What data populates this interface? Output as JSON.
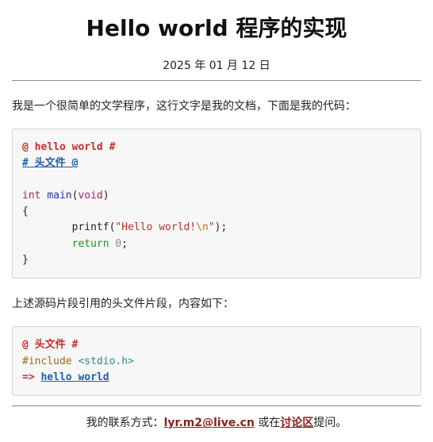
{
  "header": {
    "title": "Hello world 程序的实现",
    "date": "2025 年 01 月 12 日"
  },
  "intro": {
    "text": "我是一个很简单的文学程序，这行文字是我的文档，下面是我的代码："
  },
  "code_main": {
    "line1": {
      "meta": "@ hello world #"
    },
    "line2": {
      "link": "# 头文件 @"
    },
    "line4": {
      "kw": "int",
      "sp": " ",
      "fn": "main",
      "open": "(",
      "kw2": "void",
      "close": ")"
    },
    "line5": {
      "brace": "{"
    },
    "line6": {
      "indent": "        ",
      "fn": "printf",
      "open": "(",
      "str": "\"Hello world!",
      "esc": "\\n",
      "str_end": "\"",
      "close": ");"
    },
    "line7": {
      "indent": "        ",
      "ret": "return",
      "sp": " ",
      "num": "0",
      "semi": ";"
    },
    "line8": {
      "brace": "}"
    }
  },
  "middle": {
    "text": "上述源码片段引用的头文件片段，内容如下："
  },
  "code_header": {
    "line1": {
      "meta": "@ 头文件 #"
    },
    "line2": {
      "pre": "#include",
      "sp": " ",
      "hdr": "<stdio.h>"
    },
    "line3": {
      "arrow": "=>",
      "sp": " ",
      "link": "hello world"
    }
  },
  "footer": {
    "prefix": "我的联系方式：",
    "email": "lyr.m2@live.cn",
    "middle": " 或在",
    "forum": "讨论区",
    "suffix": "提问。"
  }
}
